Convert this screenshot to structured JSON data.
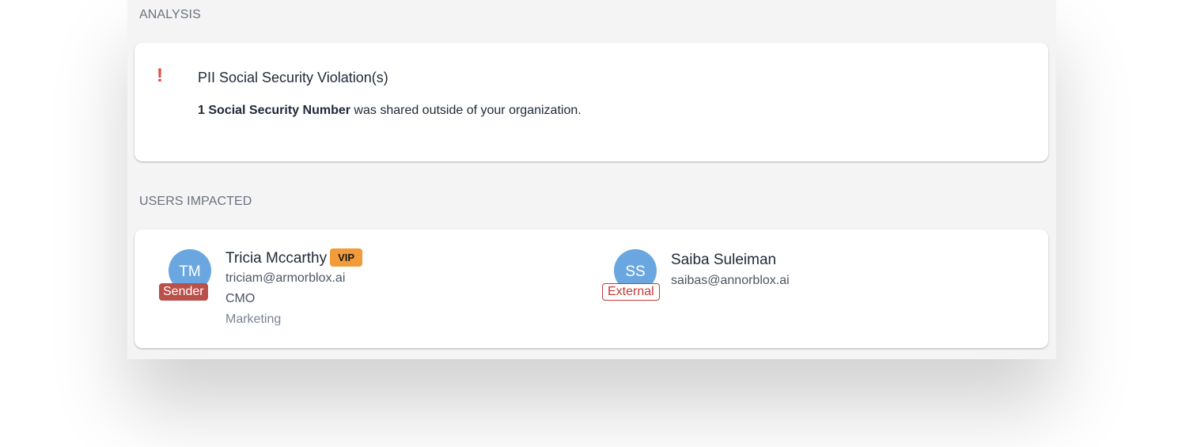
{
  "analysis": {
    "heading": "ANALYSIS",
    "alert_icon": "!",
    "alert_icon_name": "exclamation-icon",
    "alert_color": "#e2483d",
    "violation_title": "PII Social Security Violation(s)",
    "violation_count_text": "1 Social Security Number",
    "violation_rest_text": " was shared outside of your organization."
  },
  "users_impacted": {
    "heading": "USERS IMPACTED",
    "users": [
      {
        "initials": "TM",
        "name": "Tricia Mccarthy",
        "tag": "VIP",
        "role": "Sender",
        "email": "triciam@armorblox.ai",
        "title": "CMO",
        "department": "Marketing"
      },
      {
        "initials": "SS",
        "name": "Saiba Suleiman",
        "role": "External",
        "email": "saibas@annorblox.ai"
      }
    ]
  },
  "colors": {
    "avatar": "#6aa7e0",
    "sender_badge": "#b9504a",
    "external_badge": "#c23a36",
    "vip_badge": "#f29b38"
  }
}
